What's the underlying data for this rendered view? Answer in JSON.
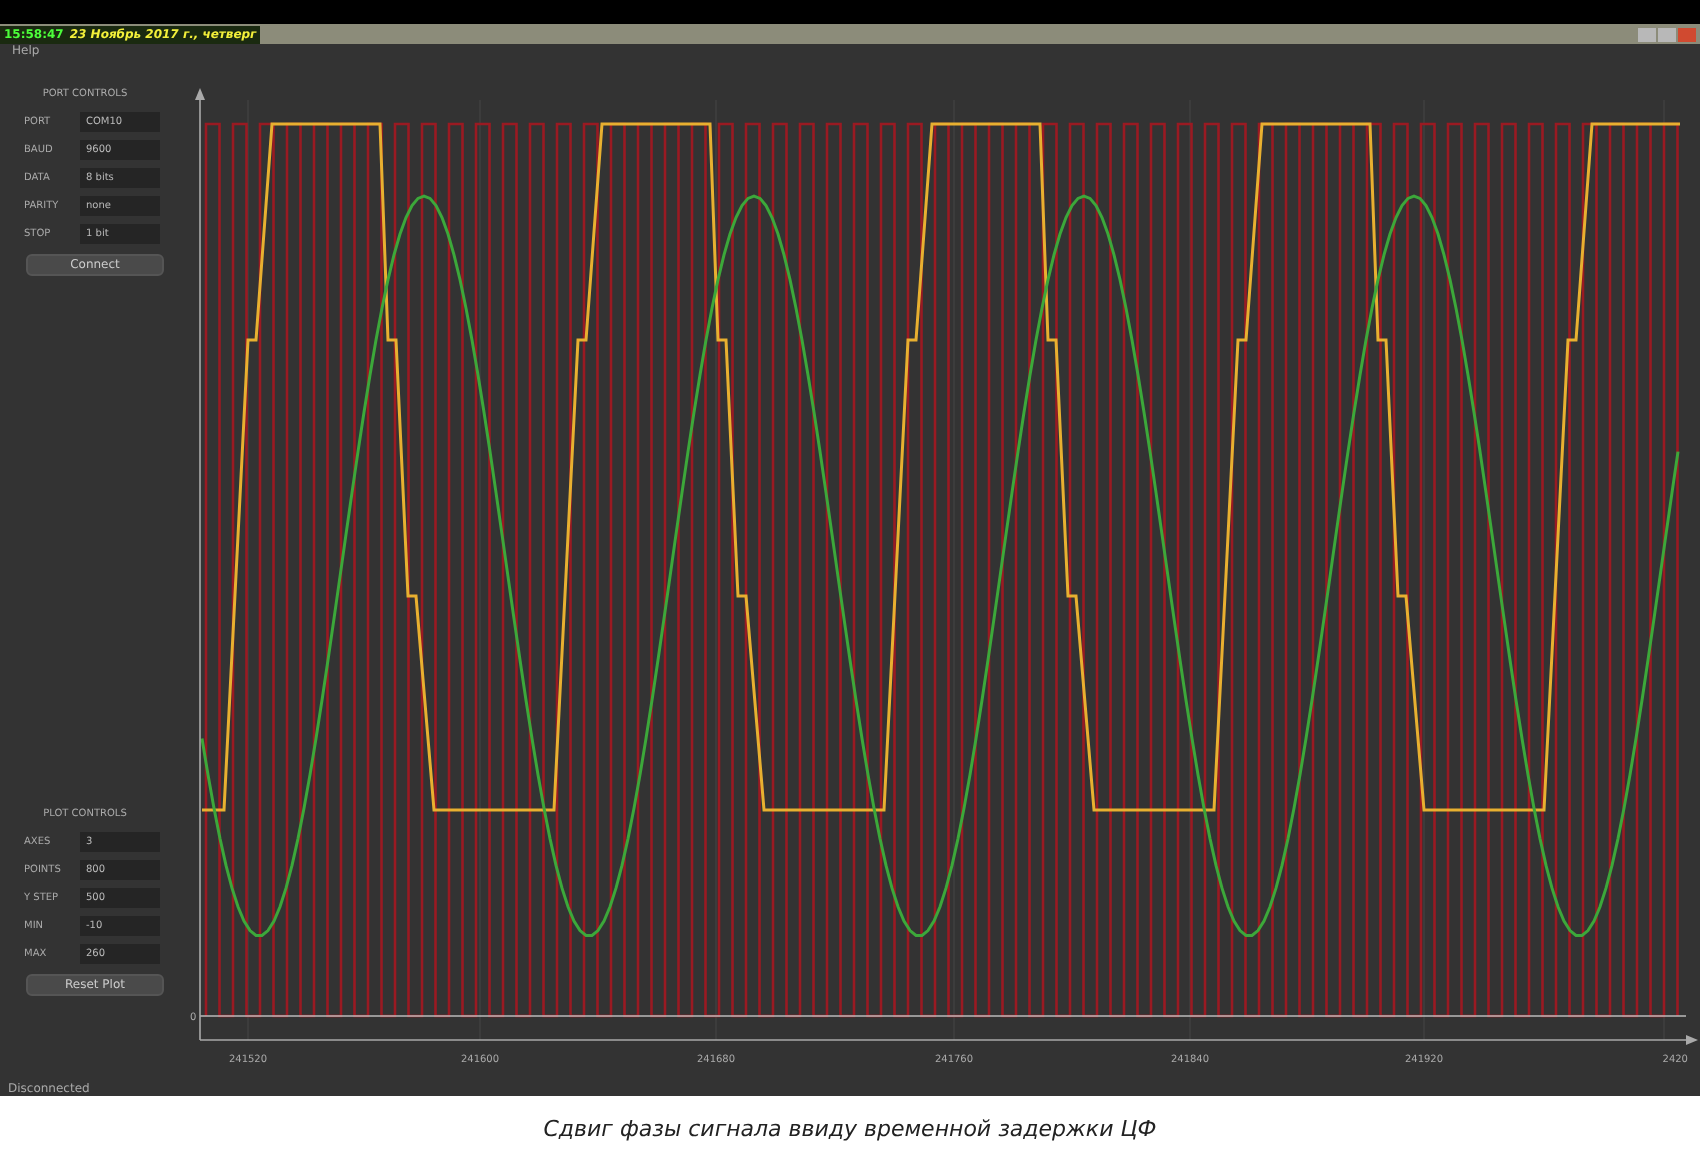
{
  "title_bar": {
    "time": "15:58:47",
    "date": "23 Ноябрь 2017 г., четверг"
  },
  "menu": [
    "Help"
  ],
  "port_controls": {
    "heading": "PORT CONTROLS",
    "rows": [
      {
        "label": "PORT",
        "value": "COM10"
      },
      {
        "label": "BAUD",
        "value": "9600"
      },
      {
        "label": "DATA",
        "value": "8 bits"
      },
      {
        "label": "PARITY",
        "value": "none"
      },
      {
        "label": "STOP",
        "value": "1 bit"
      }
    ],
    "button": "Connect"
  },
  "plot_controls": {
    "heading": "PLOT CONTROLS",
    "rows": [
      {
        "label": "AXES",
        "value": "3"
      },
      {
        "label": "POINTS",
        "value": "800"
      },
      {
        "label": "Y STEP",
        "value": "500"
      },
      {
        "label": "MIN",
        "value": "-10"
      },
      {
        "label": "MAX",
        "value": "260"
      }
    ],
    "button": "Reset Plot"
  },
  "plot": {
    "y_tick": "0",
    "x_ticks": [
      "241520",
      "241600",
      "241680",
      "241760",
      "241840",
      "241920",
      "2420"
    ]
  },
  "status": "Disconnected",
  "caption": "Сдвиг фазы сигнала ввиду временной задержки ЦФ"
}
